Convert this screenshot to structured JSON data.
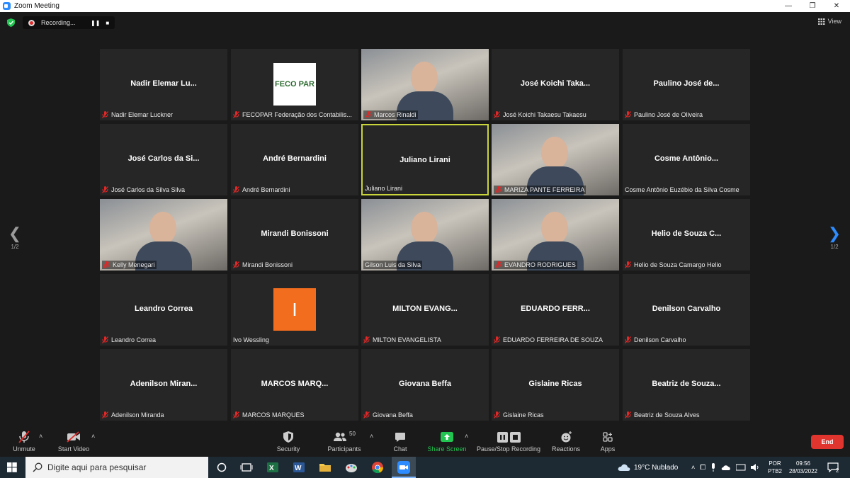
{
  "window": {
    "title": "Zoom Meeting",
    "minimize": "—",
    "restore": "❐",
    "close": "✕"
  },
  "recording": {
    "text": "Recording...",
    "pause": "❚❚",
    "stop": "■"
  },
  "view_label": "View",
  "pager": {
    "left": "1/2",
    "right": "1/2"
  },
  "participants": [
    {
      "big": "Nadir Elemar Lu...",
      "label": "Nadir Elemar Luckner",
      "muted": true,
      "video": "none"
    },
    {
      "big": "",
      "label": "FECOPAR Federação dos Contabilis...",
      "muted": true,
      "video": "logo",
      "logo_text": "FECO PAR"
    },
    {
      "big": "",
      "label": "Marcos Rinaldi",
      "muted": true,
      "video": "camera"
    },
    {
      "big": "José Koichi Taka...",
      "label": "José Koichi Takaesu Takaesu",
      "muted": true,
      "video": "none"
    },
    {
      "big": "Paulino José de...",
      "label": "Paulino José de Oliveira",
      "muted": true,
      "video": "none"
    },
    {
      "big": "José Carlos da Si...",
      "label": "José Carlos da Silva Silva",
      "muted": true,
      "video": "none"
    },
    {
      "big": "André Bernardini",
      "label": "André Bernardini",
      "muted": true,
      "video": "none"
    },
    {
      "big": "Juliano Lirani",
      "label": "Juliano Lirani",
      "muted": false,
      "video": "none",
      "active": true
    },
    {
      "big": "",
      "label": "MARIZA PANTE FERREIRA",
      "muted": true,
      "video": "camera"
    },
    {
      "big": "Cosme Antônio...",
      "label": "Cosme Antônio Euzébio da Silva Cosme",
      "muted": false,
      "video": "none"
    },
    {
      "big": "",
      "label": "Kelly Menegari",
      "muted": true,
      "video": "camera"
    },
    {
      "big": "Mirandi Bonissoni",
      "label": "Mirandi Bonissoni",
      "muted": true,
      "video": "none"
    },
    {
      "big": "",
      "label": "Gilson Luis da Silva",
      "muted": false,
      "video": "camera"
    },
    {
      "big": "",
      "label": "EVANDRO RODRIGUES",
      "muted": true,
      "video": "camera"
    },
    {
      "big": "Helio de Souza C...",
      "label": "Helio de Souza Camargo Helio",
      "muted": true,
      "video": "none"
    },
    {
      "big": "Leandro Correa",
      "label": "Leandro Correa",
      "muted": true,
      "video": "none"
    },
    {
      "big": "",
      "label": "Ivo Wessling",
      "muted": false,
      "video": "avatar",
      "avatar_letter": "I"
    },
    {
      "big": "MILTON EVANG...",
      "label": "MILTON EVANGELISTA",
      "muted": true,
      "video": "none"
    },
    {
      "big": "EDUARDO FERR...",
      "label": "EDUARDO FERREIRA DE SOUZA",
      "muted": true,
      "video": "none"
    },
    {
      "big": "Denilson Carvalho",
      "label": "Denilson Carvalho",
      "muted": true,
      "video": "none"
    },
    {
      "big": "Adenilson Miran...",
      "label": "Adenilson Miranda",
      "muted": true,
      "video": "none"
    },
    {
      "big": "MARCOS MARQ...",
      "label": "MARCOS MARQUES",
      "muted": true,
      "video": "none"
    },
    {
      "big": "Giovana Beffa",
      "label": "Giovana Beffa",
      "muted": true,
      "video": "none"
    },
    {
      "big": "Gislaine Ricas",
      "label": "Gislaine Ricas",
      "muted": true,
      "video": "none"
    },
    {
      "big": "Beatriz de Souza...",
      "label": "Beatriz de Souza Alves",
      "muted": true,
      "video": "none"
    }
  ],
  "toolbar": {
    "unmute": "Unmute",
    "start_video": "Start Video",
    "security": "Security",
    "participants": "Participants",
    "participants_count": "50",
    "chat": "Chat",
    "share_screen": "Share Screen",
    "recording": "Pause/Stop Recording",
    "reactions": "Reactions",
    "apps": "Apps",
    "end": "End"
  },
  "taskbar": {
    "search_placeholder": "Digite aqui para pesquisar",
    "weather": "19°C  Nublado",
    "lang_top": "POR",
    "lang_bottom": "PTB2",
    "time": "09:56",
    "date": "28/03/2022",
    "notifications": "2"
  },
  "colors": {
    "accent": "#2d8cff",
    "active_speaker": "#c9d53a",
    "end": "#e0342f",
    "share": "#23c552",
    "muted_mic": "#e02828"
  }
}
